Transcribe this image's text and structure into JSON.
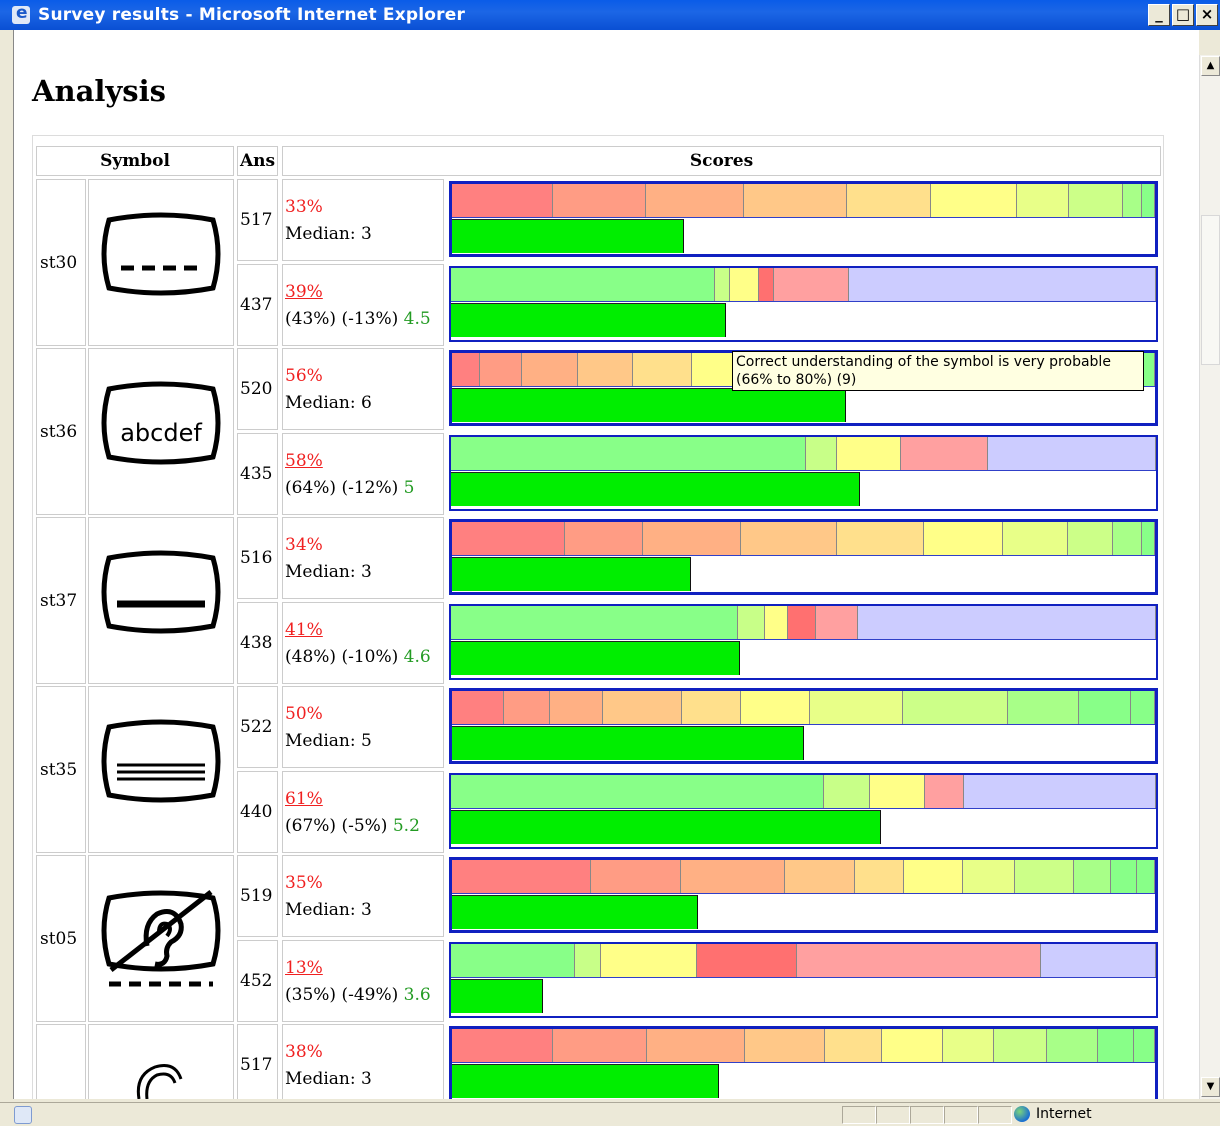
{
  "window": {
    "title": "Survey results - Microsoft Internet Explorer",
    "minimize": "_",
    "maximize": "□",
    "close": "×"
  },
  "page": {
    "title": "Analysis"
  },
  "table": {
    "headers": {
      "symbol": "Symbol",
      "ans": "Ans",
      "scores": "Scores"
    }
  },
  "colors": {
    "border": "#1020c0",
    "score_bar": "#00ee00",
    "red_text": "#f02020",
    "green_text": "#239b23",
    "scale": [
      "#ff8080",
      "#ff9c84",
      "#ffb084",
      "#ffc888",
      "#ffe08c",
      "#ffff88",
      "#e8ff88",
      "#ccff88",
      "#a8ff88",
      "#88ff88"
    ],
    "green": "#88ff88",
    "lightgreen": "#c8ff88",
    "yellow": "#ffff88",
    "red": "#ff7070",
    "pink": "#ffa0a0",
    "lavender": "#ccccff"
  },
  "tooltip": {
    "text": "Correct understanding of the symbol is very probable (66% to 80%) (9)"
  },
  "rows": [
    {
      "code": "st30",
      "symbol": "tv-dashed-line-icon",
      "a": {
        "ans": "517",
        "pct": "33%",
        "line2": "Median: 3",
        "score": 0.33,
        "segs": [
          [
            101,
            "#ff8080"
          ],
          [
            92,
            "#ff9c84"
          ],
          [
            98,
            "#ffb084"
          ],
          [
            103,
            "#ffc888"
          ],
          [
            83,
            "#ffe08c"
          ],
          [
            86,
            "#ffff88"
          ],
          [
            51,
            "#e8ff88"
          ],
          [
            54,
            "#ccff88"
          ],
          [
            18,
            "#a8ff88"
          ],
          [
            12,
            "#88ff88"
          ]
        ]
      },
      "b": {
        "ans": "437",
        "pct": "39%",
        "line2": "(43%) (-13%) ",
        "mean": "4.5",
        "score": 0.39,
        "segs": [
          [
            263,
            "#88ff88"
          ],
          [
            14,
            "#c8ff88"
          ],
          [
            28,
            "#ffff88"
          ],
          [
            14,
            "#ff7070"
          ],
          [
            75,
            "#ffa0a0"
          ],
          [
            306,
            "#ccccff"
          ]
        ]
      }
    },
    {
      "code": "st36",
      "symbol": "tv-abcdef-icon",
      "label": "abcdef",
      "a": {
        "ans": "520",
        "pct": "56%",
        "line2": "Median: 6",
        "score": 0.56,
        "segs": [
          [
            25,
            "#ff8080"
          ],
          [
            39,
            "#ff9c84"
          ],
          [
            51,
            "#ffb084"
          ],
          [
            51,
            "#ffc888"
          ],
          [
            54,
            "#ffe08c"
          ],
          [
            89,
            "#ffff88"
          ],
          [
            67,
            "#e8ff88"
          ],
          [
            127,
            "#ccff88"
          ],
          [
            111,
            "#a8ff88"
          ],
          [
            36,
            "#88ff88"
          ]
        ]
      },
      "b": {
        "ans": "435",
        "pct": "58%",
        "line2": "(64%) (-12%) ",
        "mean": "5",
        "score": 0.58,
        "segs": [
          [
            354,
            "#88ff88"
          ],
          [
            30,
            "#c8ff88"
          ],
          [
            63,
            "#ffff88"
          ],
          [
            86,
            "#ffa0a0"
          ],
          [
            167,
            "#ccccff"
          ]
        ]
      }
    },
    {
      "code": "st37",
      "symbol": "tv-solid-line-icon",
      "a": {
        "ans": "516",
        "pct": "34%",
        "line2": "Median: 3",
        "score": 0.34,
        "segs": [
          [
            113,
            "#ff8080"
          ],
          [
            78,
            "#ff9c84"
          ],
          [
            98,
            "#ffb084"
          ],
          [
            96,
            "#ffc888"
          ],
          [
            87,
            "#ffe08c"
          ],
          [
            78,
            "#ffff88"
          ],
          [
            65,
            "#e8ff88"
          ],
          [
            45,
            "#ccff88"
          ],
          [
            28,
            "#a8ff88"
          ],
          [
            12,
            "#88ff88"
          ]
        ]
      },
      "b": {
        "ans": "438",
        "pct": "41%",
        "line2": "(48%) (-10%) ",
        "mean": "4.6",
        "score": 0.41,
        "segs": [
          [
            286,
            "#88ff88"
          ],
          [
            26,
            "#c8ff88"
          ],
          [
            22,
            "#ffff88"
          ],
          [
            27,
            "#ff7070"
          ],
          [
            42,
            "#ffa0a0"
          ],
          [
            297,
            "#ccccff"
          ]
        ]
      }
    },
    {
      "code": "st35",
      "symbol": "tv-three-lines-icon",
      "a": {
        "ans": "522",
        "pct": "50%",
        "line2": "Median: 5",
        "score": 0.5,
        "segs": [
          [
            52,
            "#ff8080"
          ],
          [
            45,
            "#ff9c84"
          ],
          [
            53,
            "#ffb084"
          ],
          [
            79,
            "#ffc888"
          ],
          [
            58,
            "#ffe08c"
          ],
          [
            69,
            "#ffff88"
          ],
          [
            93,
            "#e8ff88"
          ],
          [
            105,
            "#ccff88"
          ],
          [
            71,
            "#a8ff88"
          ],
          [
            52,
            "#88ff88"
          ],
          [
            23,
            "#88ff88"
          ]
        ]
      },
      "b": {
        "ans": "440",
        "pct": "61%",
        "line2": "(67%) (-5%) ",
        "mean": "5.2",
        "score": 0.61,
        "segs": [
          [
            372,
            "#88ff88"
          ],
          [
            45,
            "#c8ff88"
          ],
          [
            54,
            "#ffff88"
          ],
          [
            38,
            "#ffa0a0"
          ],
          [
            191,
            "#ccccff"
          ]
        ]
      }
    },
    {
      "code": "st05",
      "symbol": "tv-no-hearing-icon",
      "a": {
        "ans": "519",
        "pct": "35%",
        "line2": "Median: 3",
        "score": 0.35,
        "segs": [
          [
            140,
            "#ff8080"
          ],
          [
            90,
            "#ff9c84"
          ],
          [
            104,
            "#ffb084"
          ],
          [
            70,
            "#ffc888"
          ],
          [
            48,
            "#ffe08c"
          ],
          [
            59,
            "#ffff88"
          ],
          [
            51,
            "#e8ff88"
          ],
          [
            59,
            "#ccff88"
          ],
          [
            36,
            "#a8ff88"
          ],
          [
            26,
            "#88ff88"
          ],
          [
            17,
            "#88ff88"
          ]
        ]
      },
      "b": {
        "ans": "452",
        "pct": "13%",
        "line2": "(35%) (-49%) ",
        "mean": "3.6",
        "score": 0.13,
        "segs": [
          [
            123,
            "#88ff88"
          ],
          [
            25,
            "#c8ff88"
          ],
          [
            95,
            "#ffff88"
          ],
          [
            99,
            "#ff7070"
          ],
          [
            244,
            "#ffa0a0"
          ],
          [
            114,
            "#ccccff"
          ]
        ]
      }
    },
    {
      "code": "",
      "symbol": "hearing-icon",
      "a": {
        "ans": "517",
        "pct": "38%",
        "line2": "Median: 3",
        "score": 0.38,
        "segs": [
          [
            101,
            "#ff8080"
          ],
          [
            94,
            "#ff9c84"
          ],
          [
            98,
            "#ffb084"
          ],
          [
            80,
            "#ffc888"
          ],
          [
            57,
            "#ffe08c"
          ],
          [
            61,
            "#ffff88"
          ],
          [
            50,
            "#e8ff88"
          ],
          [
            53,
            "#ccff88"
          ],
          [
            50,
            "#a8ff88"
          ],
          [
            36,
            "#88ff88"
          ],
          [
            20,
            "#88ff88"
          ]
        ]
      }
    }
  ],
  "statusbar": {
    "zone": "Internet"
  }
}
